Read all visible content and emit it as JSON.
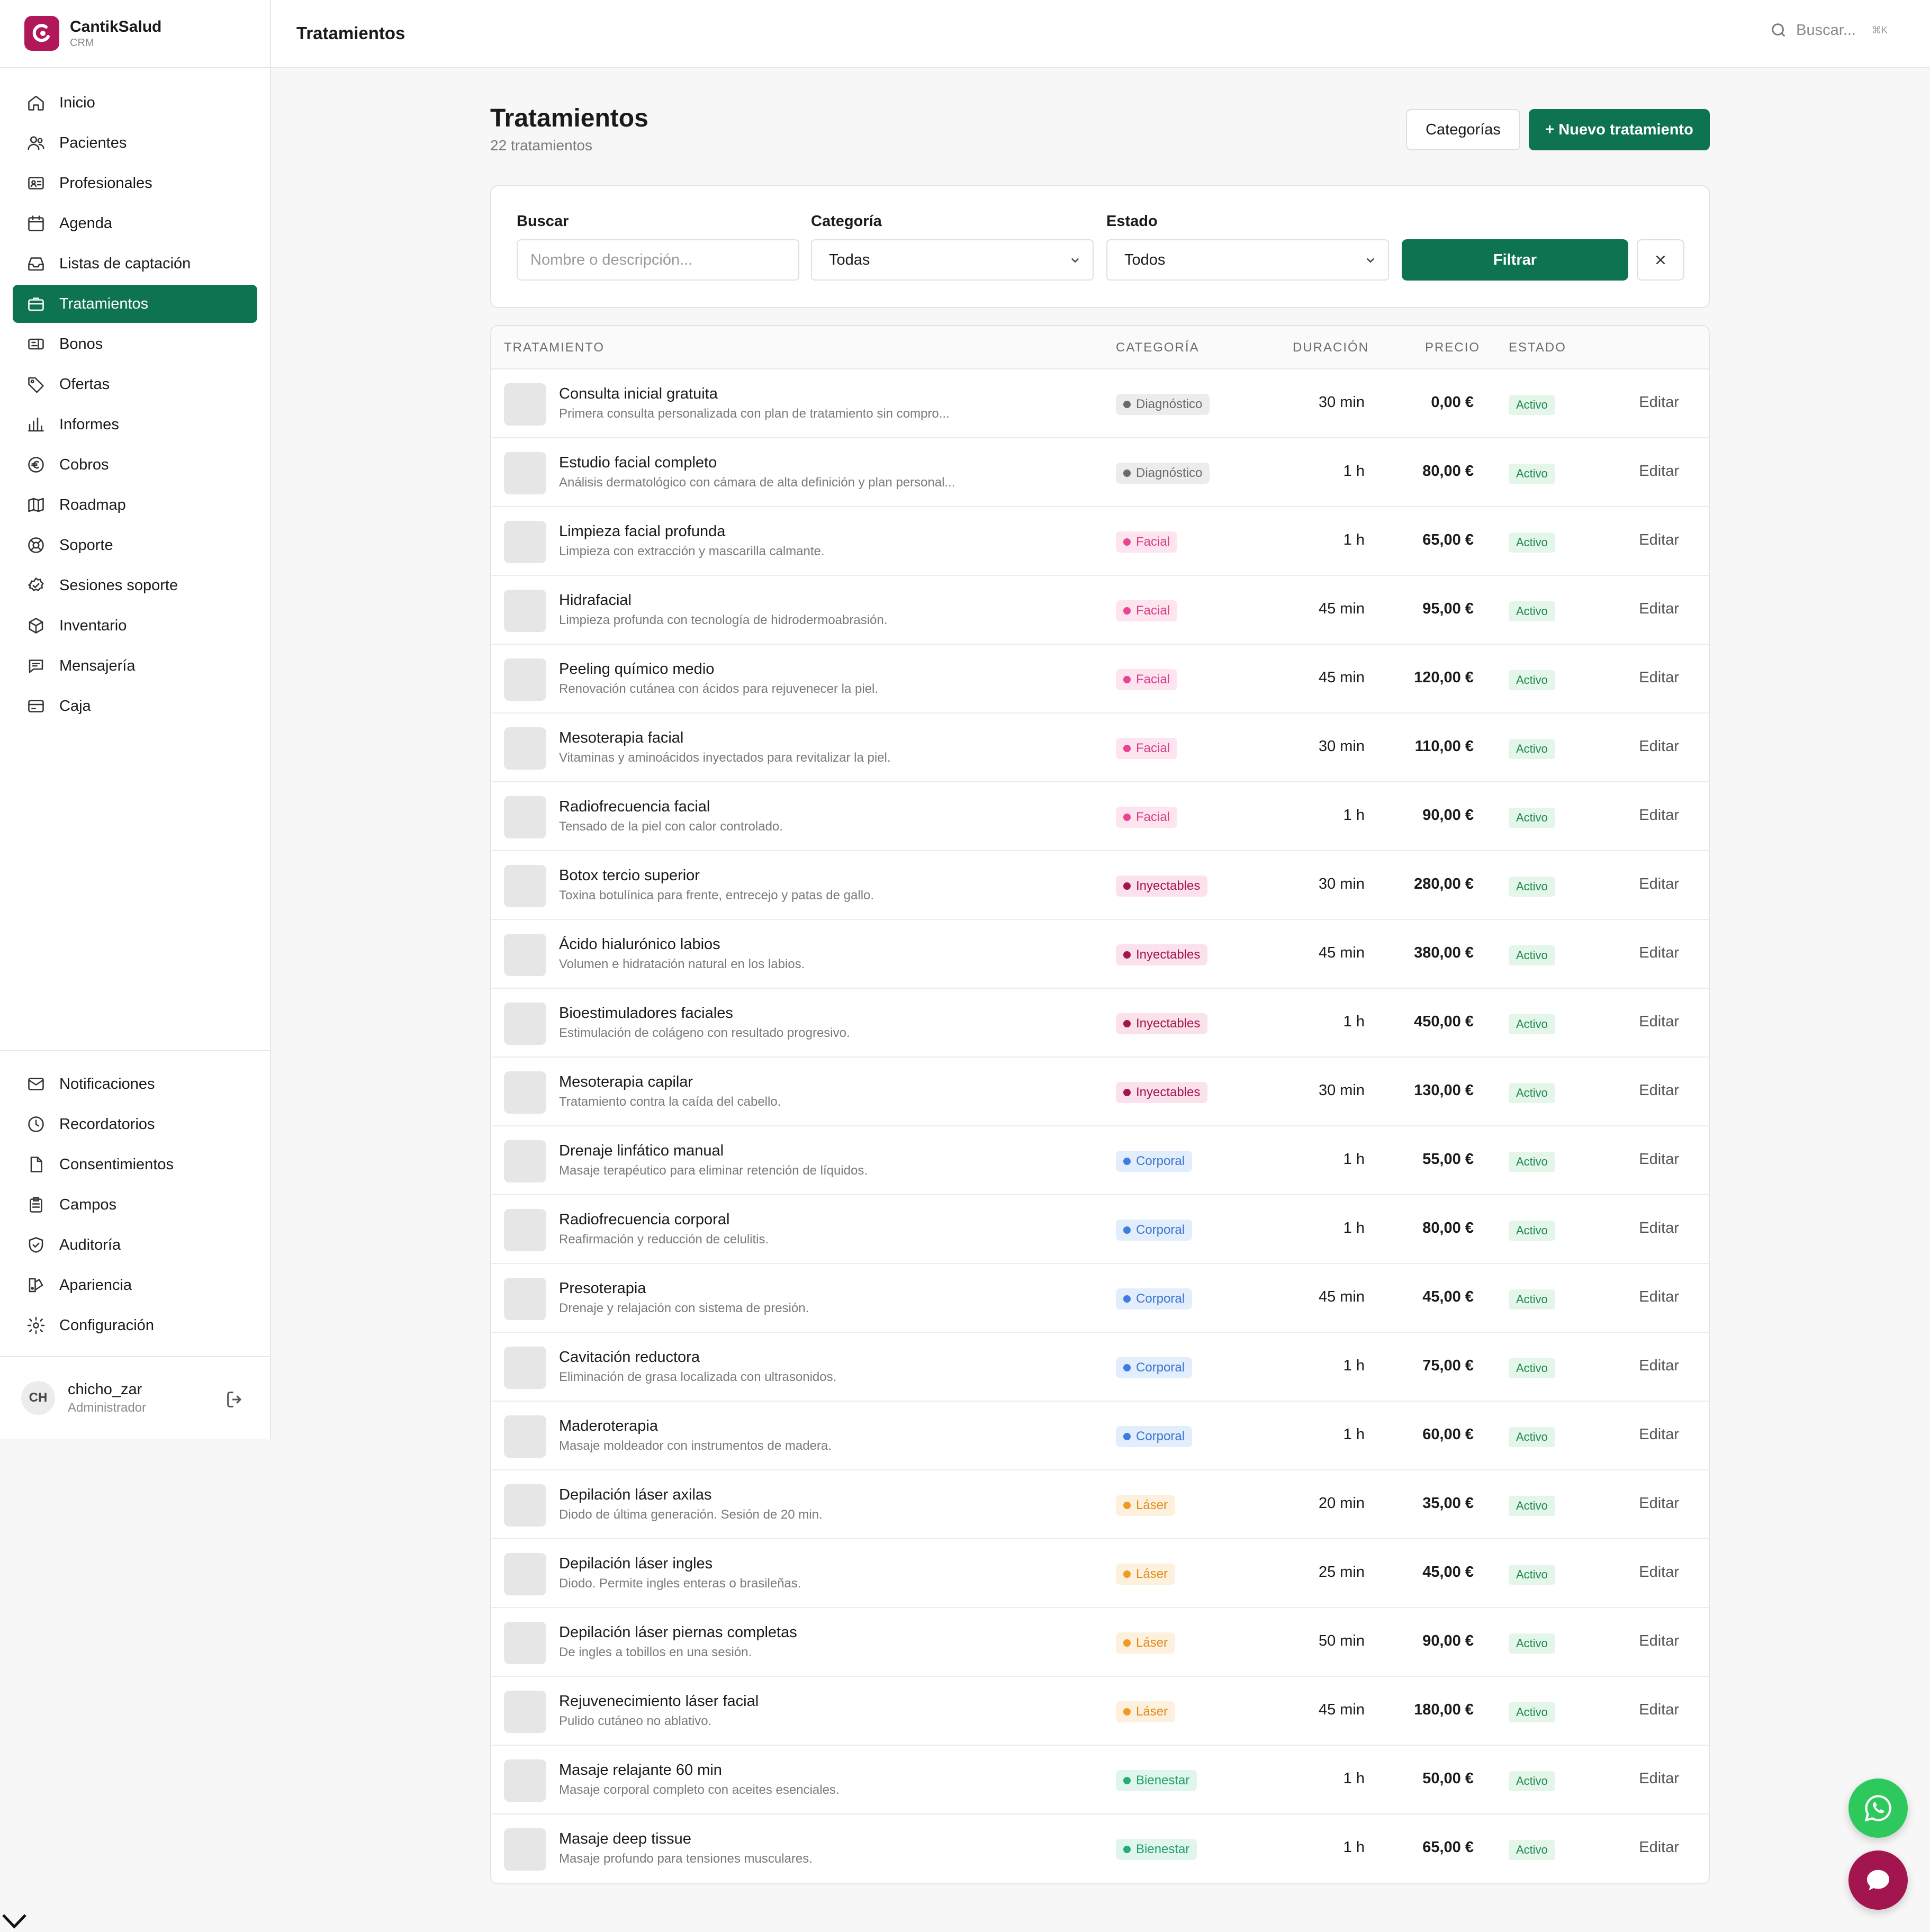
{
  "brand": {
    "name": "CantikSalud",
    "sub": "CRM"
  },
  "nav": [
    {
      "label": "Inicio",
      "icon": "home-icon",
      "active": false
    },
    {
      "label": "Pacientes",
      "icon": "users-icon",
      "active": false
    },
    {
      "label": "Profesionales",
      "icon": "id-card-icon",
      "active": false
    },
    {
      "label": "Agenda",
      "icon": "calendar-icon",
      "active": false
    },
    {
      "label": "Listas de captación",
      "icon": "inbox-icon",
      "active": false
    },
    {
      "label": "Tratamientos",
      "icon": "briefcase-icon",
      "active": true
    },
    {
      "label": "Bonos",
      "icon": "ticket-icon",
      "active": false
    },
    {
      "label": "Ofertas",
      "icon": "tag-icon",
      "active": false
    },
    {
      "label": "Informes",
      "icon": "bar-chart-icon",
      "active": false
    },
    {
      "label": "Cobros",
      "icon": "euro-icon",
      "active": false
    },
    {
      "label": "Roadmap",
      "icon": "map-icon",
      "active": false
    },
    {
      "label": "Soporte",
      "icon": "lifebuoy-icon",
      "active": false
    },
    {
      "label": "Sesiones soporte",
      "icon": "check-badge-icon",
      "active": false
    },
    {
      "label": "Inventario",
      "icon": "box-icon",
      "active": false
    },
    {
      "label": "Mensajería",
      "icon": "chat-icon",
      "active": false
    },
    {
      "label": "Caja",
      "icon": "credit-card-icon",
      "active": false
    }
  ],
  "nav_bottom": [
    {
      "label": "Notificaciones",
      "icon": "mail-icon"
    },
    {
      "label": "Recordatorios",
      "icon": "clock-icon"
    },
    {
      "label": "Consentimientos",
      "icon": "document-icon"
    },
    {
      "label": "Campos",
      "icon": "clipboard-icon"
    },
    {
      "label": "Auditoría",
      "icon": "shield-check-icon"
    },
    {
      "label": "Apariencia",
      "icon": "palette-icon"
    },
    {
      "label": "Configuración",
      "icon": "gear-icon"
    }
  ],
  "user": {
    "initials": "CH",
    "name": "chicho_zar",
    "role": "Administrador"
  },
  "topbar": {
    "title": "Tratamientos",
    "search_placeholder": "Buscar...",
    "shortcut": "⌘K"
  },
  "page": {
    "title": "Tratamientos",
    "count": "22 tratamientos",
    "btn_categories": "Categorías",
    "btn_new": "+ Nuevo tratamiento"
  },
  "filters": {
    "search_label": "Buscar",
    "search_placeholder": "Nombre o descripción...",
    "category_label": "Categoría",
    "category_value": "Todas",
    "state_label": "Estado",
    "state_value": "Todos",
    "filter_button": "Filtrar"
  },
  "table": {
    "headers": {
      "treatment": "TRATAMIENTO",
      "category": "CATEGORÍA",
      "duration": "DURACIÓN",
      "price": "PRECIO",
      "state": "ESTADO"
    },
    "edit_label": "Editar",
    "rows": [
      {
        "name": "Consulta inicial gratuita",
        "desc": "Primera consulta personalizada con plan de tratamiento sin compro...",
        "cat": "Diagnóstico",
        "dur": "30 min",
        "price": "0,00 €",
        "state": "Activo"
      },
      {
        "name": "Estudio facial completo",
        "desc": "Análisis dermatológico con cámara de alta definición y plan personal...",
        "cat": "Diagnóstico",
        "dur": "1 h",
        "price": "80,00 €",
        "state": "Activo"
      },
      {
        "name": "Limpieza facial profunda",
        "desc": "Limpieza con extracción y mascarilla calmante.",
        "cat": "Facial",
        "dur": "1 h",
        "price": "65,00 €",
        "state": "Activo"
      },
      {
        "name": "Hidrafacial",
        "desc": "Limpieza profunda con tecnología de hidrodermoabrasión.",
        "cat": "Facial",
        "dur": "45 min",
        "price": "95,00 €",
        "state": "Activo"
      },
      {
        "name": "Peeling químico medio",
        "desc": "Renovación cutánea con ácidos para rejuvenecer la piel.",
        "cat": "Facial",
        "dur": "45 min",
        "price": "120,00 €",
        "state": "Activo"
      },
      {
        "name": "Mesoterapia facial",
        "desc": "Vitaminas y aminoácidos inyectados para revitalizar la piel.",
        "cat": "Facial",
        "dur": "30 min",
        "price": "110,00 €",
        "state": "Activo"
      },
      {
        "name": "Radiofrecuencia facial",
        "desc": "Tensado de la piel con calor controlado.",
        "cat": "Facial",
        "dur": "1 h",
        "price": "90,00 €",
        "state": "Activo"
      },
      {
        "name": "Botox tercio superior",
        "desc": "Toxina botulínica para frente, entrecejo y patas de gallo.",
        "cat": "Inyectables",
        "dur": "30 min",
        "price": "280,00 €",
        "state": "Activo"
      },
      {
        "name": "Ácido hialurónico labios",
        "desc": "Volumen e hidratación natural en los labios.",
        "cat": "Inyectables",
        "dur": "45 min",
        "price": "380,00 €",
        "state": "Activo"
      },
      {
        "name": "Bioestimuladores faciales",
        "desc": "Estimulación de colágeno con resultado progresivo.",
        "cat": "Inyectables",
        "dur": "1 h",
        "price": "450,00 €",
        "state": "Activo"
      },
      {
        "name": "Mesoterapia capilar",
        "desc": "Tratamiento contra la caída del cabello.",
        "cat": "Inyectables",
        "dur": "30 min",
        "price": "130,00 €",
        "state": "Activo"
      },
      {
        "name": "Drenaje linfático manual",
        "desc": "Masaje terapéutico para eliminar retención de líquidos.",
        "cat": "Corporal",
        "dur": "1 h",
        "price": "55,00 €",
        "state": "Activo"
      },
      {
        "name": "Radiofrecuencia corporal",
        "desc": "Reafirmación y reducción de celulitis.",
        "cat": "Corporal",
        "dur": "1 h",
        "price": "80,00 €",
        "state": "Activo"
      },
      {
        "name": "Presoterapia",
        "desc": "Drenaje y relajación con sistema de presión.",
        "cat": "Corporal",
        "dur": "45 min",
        "price": "45,00 €",
        "state": "Activo"
      },
      {
        "name": "Cavitación reductora",
        "desc": "Eliminación de grasa localizada con ultrasonidos.",
        "cat": "Corporal",
        "dur": "1 h",
        "price": "75,00 €",
        "state": "Activo"
      },
      {
        "name": "Maderoterapia",
        "desc": "Masaje moldeador con instrumentos de madera.",
        "cat": "Corporal",
        "dur": "1 h",
        "price": "60,00 €",
        "state": "Activo"
      },
      {
        "name": "Depilación láser axilas",
        "desc": "Diodo de última generación. Sesión de 20 min.",
        "cat": "Láser",
        "dur": "20 min",
        "price": "35,00 €",
        "state": "Activo"
      },
      {
        "name": "Depilación láser ingles",
        "desc": "Diodo. Permite ingles enteras o brasileñas.",
        "cat": "Láser",
        "dur": "25 min",
        "price": "45,00 €",
        "state": "Activo"
      },
      {
        "name": "Depilación láser piernas completas",
        "desc": "De ingles a tobillos en una sesión.",
        "cat": "Láser",
        "dur": "50 min",
        "price": "90,00 €",
        "state": "Activo"
      },
      {
        "name": "Rejuvenecimiento láser facial",
        "desc": "Pulido cutáneo no ablativo.",
        "cat": "Láser",
        "dur": "45 min",
        "price": "180,00 €",
        "state": "Activo"
      },
      {
        "name": "Masaje relajante 60 min",
        "desc": "Masaje corporal completo con aceites esenciales.",
        "cat": "Bienestar",
        "dur": "1 h",
        "price": "50,00 €",
        "state": "Activo"
      },
      {
        "name": "Masaje deep tissue",
        "desc": "Masaje profundo para tensiones musculares.",
        "cat": "Bienestar",
        "dur": "1 h",
        "price": "65,00 €",
        "state": "Activo"
      }
    ]
  },
  "category_colors": {
    "Diagnóstico": {
      "bg": "#ececec",
      "fg": "#6b6b6b",
      "dot": "#6b6b6b"
    },
    "Facial": {
      "bg": "#fde4ef",
      "fg": "#d63f86",
      "dot": "#e8448f"
    },
    "Inyectables": {
      "bg": "#fbe1ea",
      "fg": "#a3154f",
      "dot": "#a3154f"
    },
    "Corporal": {
      "bg": "#e3eefc",
      "fg": "#3b74d1",
      "dot": "#3f7ee0"
    },
    "Láser": {
      "bg": "#fdf0dc",
      "fg": "#e28a1c",
      "dot": "#f09a25"
    },
    "Bienestar": {
      "bg": "#e0f6ec",
      "fg": "#23a06a",
      "dot": "#23b072"
    }
  },
  "colors": {
    "accent": "#0e7350",
    "brand": "#b1185a",
    "whatsapp": "#2dc95c"
  }
}
